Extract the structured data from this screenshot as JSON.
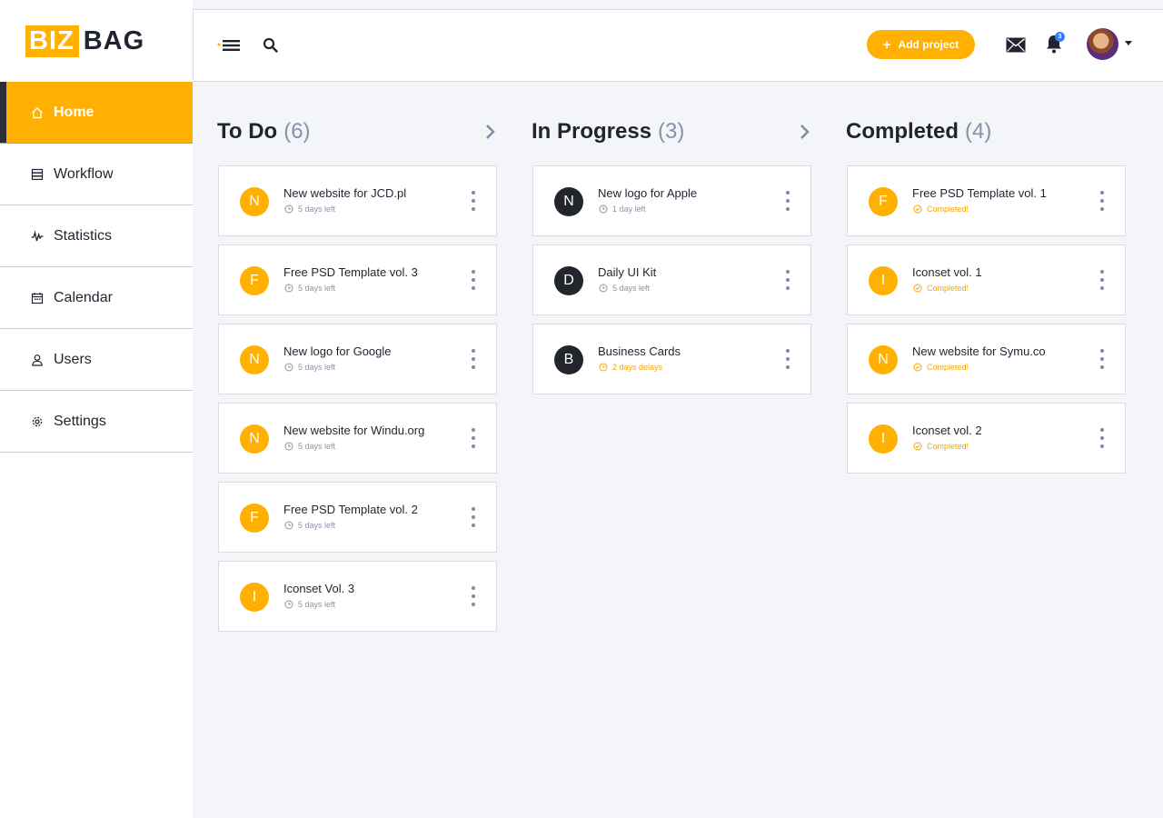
{
  "logo": {
    "part1": "BIZ",
    "part2": "BAG"
  },
  "sidebar": {
    "items": [
      {
        "label": "Home",
        "icon": "home-icon",
        "active": true
      },
      {
        "label": "Workflow",
        "icon": "workflow-icon"
      },
      {
        "label": "Statistics",
        "icon": "statistics-icon"
      },
      {
        "label": "Calendar",
        "icon": "calendar-icon"
      },
      {
        "label": "Users",
        "icon": "user-icon"
      },
      {
        "label": "Settings",
        "icon": "gear-icon"
      }
    ]
  },
  "header": {
    "add_project_label": "Add project",
    "notification_count": "3",
    "icons": [
      "menu-icon",
      "search-icon",
      "mail-icon",
      "bell-icon",
      "avatar",
      "caret-down-icon"
    ]
  },
  "colors": {
    "accent": "#ffb000",
    "dark": "#22252c",
    "badge": "#3a7bfd",
    "muted": "#8791a8"
  },
  "columns": [
    {
      "title": "To Do",
      "count": "(6)",
      "cards": [
        {
          "initial": "N",
          "title": "New website for JCD.pl",
          "meta": "5 days left"
        },
        {
          "initial": "F",
          "title": "Free PSD Template vol. 3",
          "meta": "5 days left"
        },
        {
          "initial": "N",
          "title": "New logo for Google",
          "meta": "5 days left"
        },
        {
          "initial": "N",
          "title": "New website for Windu.org",
          "meta": "5 days left"
        },
        {
          "initial": "F",
          "title": "Free PSD Template vol. 2",
          "meta": "5 days left"
        },
        {
          "initial": "I",
          "title": "Iconset Vol. 3",
          "meta": "5 days left"
        }
      ]
    },
    {
      "title": "In Progress",
      "count": "(3)",
      "cards": [
        {
          "initial": "N",
          "title": "New logo for Apple",
          "meta": "1 day left"
        },
        {
          "initial": "D",
          "title": "Daily UI Kit",
          "meta": "5 days left"
        },
        {
          "initial": "B",
          "title": "Business Cards",
          "meta": "2 days delays"
        }
      ]
    },
    {
      "title": "Completed",
      "count": "(4)",
      "cards": [
        {
          "initial": "F",
          "title": "Free PSD Template vol. 1",
          "meta": "Completed!"
        },
        {
          "initial": "I",
          "title": "Iconset vol. 1",
          "meta": "Completed!"
        },
        {
          "initial": "N",
          "title": "New website for Symu.co",
          "meta": "Completed!"
        },
        {
          "initial": "I",
          "title": "Iconset vol. 2",
          "meta": "Completed!"
        }
      ]
    }
  ]
}
